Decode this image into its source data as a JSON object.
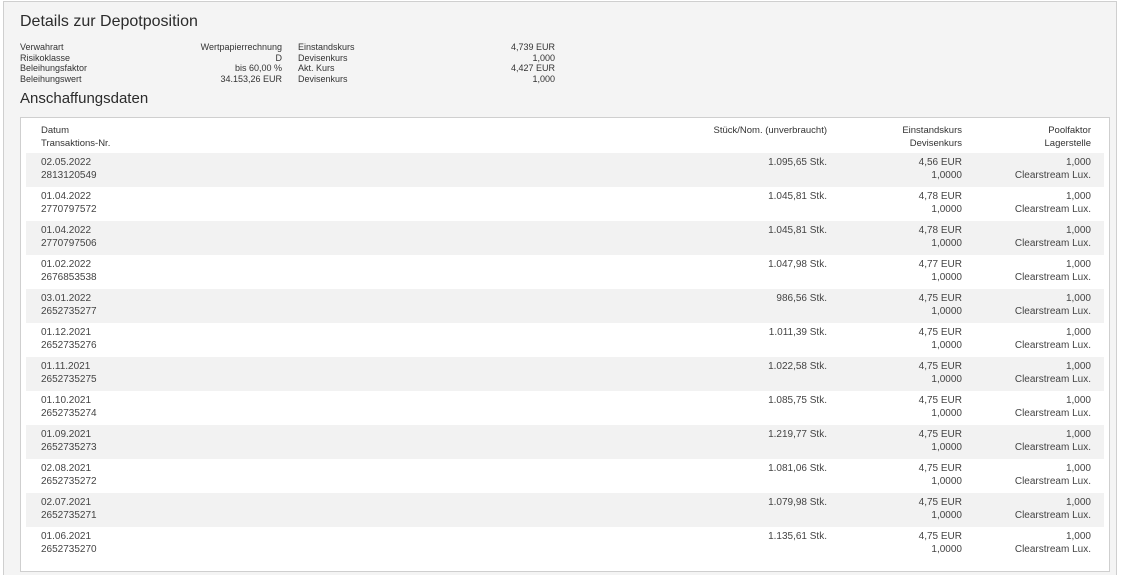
{
  "title": "Details zur Depotposition",
  "section_title": "Anschaffungsdaten",
  "details": [
    {
      "label1": "Verwahrart",
      "value1": "Wertpapierrechnung",
      "label2": "Einstandskurs",
      "value2": "4,739 EUR"
    },
    {
      "label1": "Risikoklasse",
      "value1": "D",
      "label2": "Devisenkurs",
      "value2": "1,000"
    },
    {
      "label1": "Beleihungsfaktor",
      "value1": "bis 60,00 %",
      "label2": "Akt. Kurs",
      "value2": "4,427 EUR"
    },
    {
      "label1": "Beleihungswert",
      "value1": "34.153,26 EUR",
      "label2": "Devisenkurs",
      "value2": "1,000"
    }
  ],
  "table": {
    "headers": {
      "datum": "Datum",
      "transaktion": "Transaktions-Nr.",
      "stueck": "Stück/Nom. (unverbraucht)",
      "einstandskurs": "Einstandskurs",
      "devisenkurs": "Devisenkurs",
      "poolfaktor": "Poolfaktor",
      "lagerstelle": "Lagerstelle"
    },
    "rows": [
      {
        "date": "02.05.2022",
        "txn": "2813120549",
        "qty": "1.095,65 Stk.",
        "kurs": "4,56 EUR",
        "devisen": "1,0000",
        "pool": "1,000",
        "lager": "Clearstream Lux."
      },
      {
        "date": "01.04.2022",
        "txn": "2770797572",
        "qty": "1.045,81 Stk.",
        "kurs": "4,78 EUR",
        "devisen": "1,0000",
        "pool": "1,000",
        "lager": "Clearstream Lux."
      },
      {
        "date": "01.04.2022",
        "txn": "2770797506",
        "qty": "1.045,81 Stk.",
        "kurs": "4,78 EUR",
        "devisen": "1,0000",
        "pool": "1,000",
        "lager": "Clearstream Lux."
      },
      {
        "date": "01.02.2022",
        "txn": "2676853538",
        "qty": "1.047,98 Stk.",
        "kurs": "4,77 EUR",
        "devisen": "1,0000",
        "pool": "1,000",
        "lager": "Clearstream Lux."
      },
      {
        "date": "03.01.2022",
        "txn": "2652735277",
        "qty": "986,56 Stk.",
        "kurs": "4,75 EUR",
        "devisen": "1,0000",
        "pool": "1,000",
        "lager": "Clearstream Lux."
      },
      {
        "date": "01.12.2021",
        "txn": "2652735276",
        "qty": "1.011,39 Stk.",
        "kurs": "4,75 EUR",
        "devisen": "1,0000",
        "pool": "1,000",
        "lager": "Clearstream Lux."
      },
      {
        "date": "01.11.2021",
        "txn": "2652735275",
        "qty": "1.022,58 Stk.",
        "kurs": "4,75 EUR",
        "devisen": "1,0000",
        "pool": "1,000",
        "lager": "Clearstream Lux."
      },
      {
        "date": "01.10.2021",
        "txn": "2652735274",
        "qty": "1.085,75 Stk.",
        "kurs": "4,75 EUR",
        "devisen": "1,0000",
        "pool": "1,000",
        "lager": "Clearstream Lux."
      },
      {
        "date": "01.09.2021",
        "txn": "2652735273",
        "qty": "1.219,77 Stk.",
        "kurs": "4,75 EUR",
        "devisen": "1,0000",
        "pool": "1,000",
        "lager": "Clearstream Lux."
      },
      {
        "date": "02.08.2021",
        "txn": "2652735272",
        "qty": "1.081,06 Stk.",
        "kurs": "4,75 EUR",
        "devisen": "1,0000",
        "pool": "1,000",
        "lager": "Clearstream Lux."
      },
      {
        "date": "02.07.2021",
        "txn": "2652735271",
        "qty": "1.079,98 Stk.",
        "kurs": "4,75 EUR",
        "devisen": "1,0000",
        "pool": "1,000",
        "lager": "Clearstream Lux."
      },
      {
        "date": "01.06.2021",
        "txn": "2652735270",
        "qty": "1.135,61 Stk.",
        "kurs": "4,75 EUR",
        "devisen": "1,0000",
        "pool": "1,000",
        "lager": "Clearstream Lux."
      }
    ]
  }
}
